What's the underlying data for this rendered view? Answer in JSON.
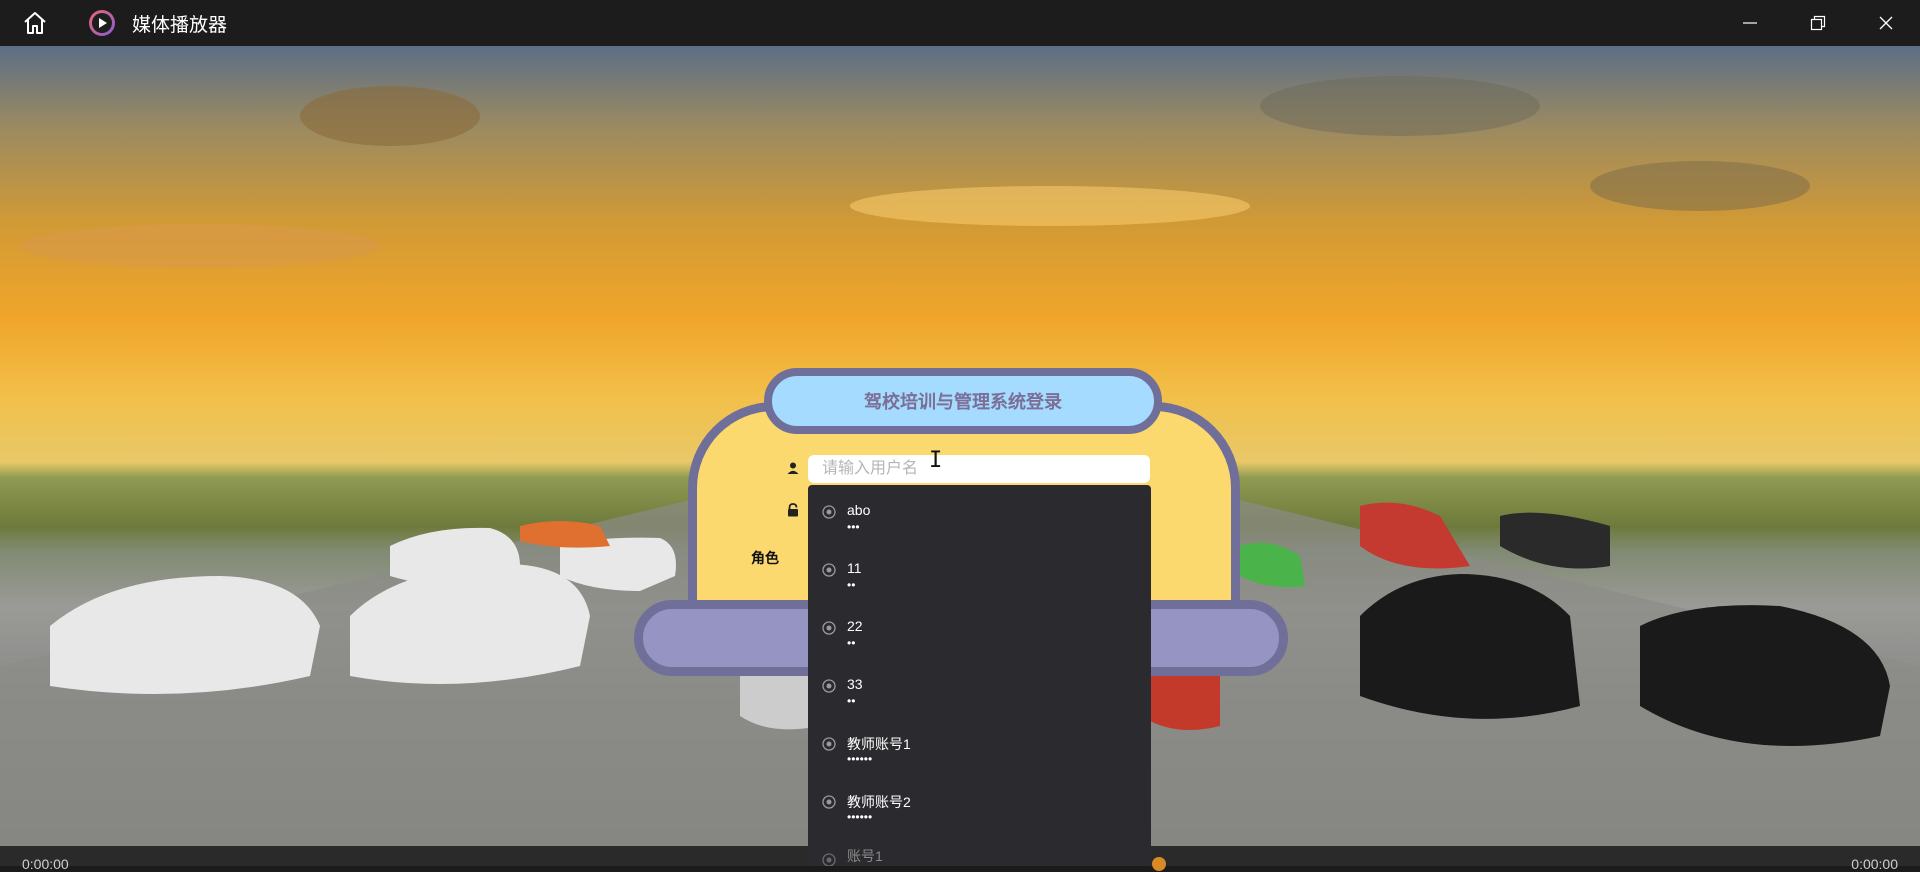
{
  "window": {
    "title": "媒体播放器",
    "controls": [
      "home-icon",
      "minimize-icon",
      "restore-icon",
      "close-icon"
    ]
  },
  "login": {
    "title": "驾校培训与管理系统登录",
    "username_placeholder": "请输入用户名",
    "role_label": "角色"
  },
  "autocomplete": {
    "items": [
      {
        "name": "abo",
        "password": "•••"
      },
      {
        "name": "11",
        "password": "••"
      },
      {
        "name": "22",
        "password": "••"
      },
      {
        "name": "33",
        "password": "••"
      },
      {
        "name": "教师账号1",
        "password": "••••••"
      },
      {
        "name": "教师账号2",
        "password": "••••••"
      },
      {
        "name": "账号1",
        "password": ""
      }
    ]
  },
  "player": {
    "time_left": "0:00:00",
    "time_right": "0:00:00"
  },
  "colors": {
    "title_bg": "#a5dbff",
    "panel_bg": "#fcd96f",
    "border": "#6f6f9a",
    "login_bar": "#9594c2",
    "dropdown_bg": "#2b2b2f"
  }
}
